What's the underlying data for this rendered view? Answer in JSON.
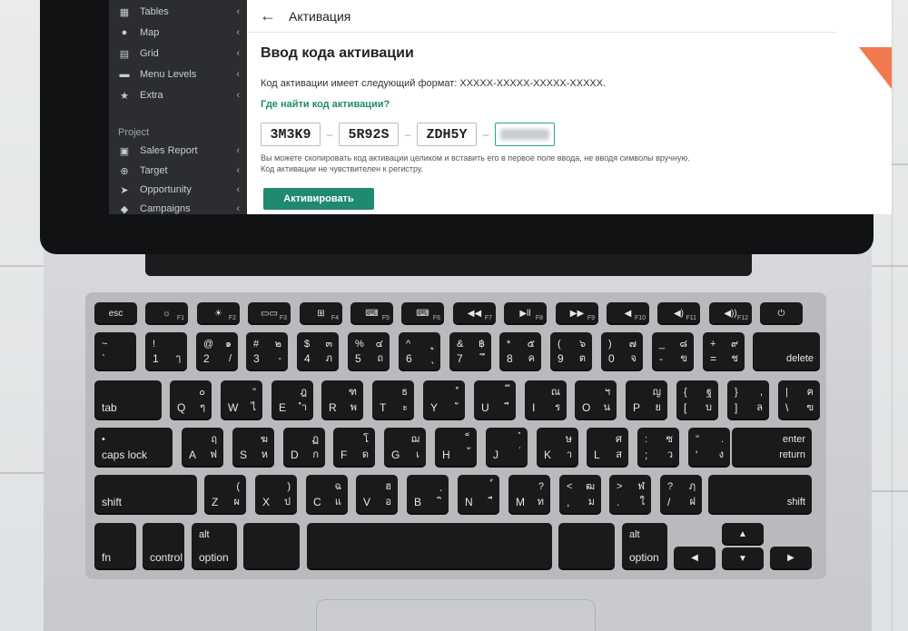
{
  "sidebar": {
    "items": [
      {
        "label": "Tables",
        "icon": "table-icon"
      },
      {
        "label": "Map",
        "icon": "map-pin-icon"
      },
      {
        "label": "Grid",
        "icon": "grid-icon"
      },
      {
        "label": "Menu Levels",
        "icon": "folder-icon"
      },
      {
        "label": "Extra",
        "icon": "star-icon"
      }
    ],
    "section_heading": "Project",
    "project_items": [
      {
        "label": "Sales Report",
        "icon": "report-icon"
      },
      {
        "label": "Target",
        "icon": "target-icon"
      },
      {
        "label": "Opportunity",
        "icon": "rocket-icon"
      },
      {
        "label": "Campaigns",
        "icon": "megaphone-icon"
      }
    ]
  },
  "header": {
    "title": "Активация"
  },
  "main": {
    "heading": "Ввод кода активации",
    "format_text": "Код активации имеет следующий формат: XXXXX-XXXXX-XXXXX-XXXXX.",
    "find_link": "Где найти код активации?",
    "code_parts": [
      "3M3K9",
      "5R92S",
      "ZDH5Y"
    ],
    "code_separator": "–",
    "hint_line1": "Вы можете скопировать код активации целиком и вставить его в первое поле ввода, не вводя символы вручную.",
    "hint_line2": "Код активации не чувствителен к регистру.",
    "activate_button": "Активировать"
  },
  "keyboard": {
    "fn_row": [
      {
        "label": "esc"
      },
      {
        "label": "☼",
        "sub": "F1"
      },
      {
        "label": "☀",
        "sub": "F2"
      },
      {
        "label": "▭▭",
        "sub": "F3"
      },
      {
        "label": "⊞",
        "sub": "F4"
      },
      {
        "label": "⌨",
        "sub": "F5"
      },
      {
        "label": "⌨",
        "sub": "F6"
      },
      {
        "label": "◀◀",
        "sub": "F7"
      },
      {
        "label": "▶ll",
        "sub": "F8"
      },
      {
        "label": "▶▶",
        "sub": "F9"
      },
      {
        "label": "◀",
        "sub": "F10"
      },
      {
        "label": "◀)",
        "sub": "F11"
      },
      {
        "label": "◀))",
        "sub": "F12"
      },
      {
        "label": "⏻"
      }
    ],
    "number_row": [
      {
        "tl": "~",
        "bl": "`",
        "tr": "",
        "br": ""
      },
      {
        "tl": "!",
        "bl": "1",
        "tr": "",
        "br": "ๅ"
      },
      {
        "tl": "@",
        "bl": "2",
        "tr": "๑",
        "br": "/"
      },
      {
        "tl": "#",
        "bl": "3",
        "tr": "๒",
        "br": "-"
      },
      {
        "tl": "$",
        "bl": "4",
        "tr": "๓",
        "br": "ภ"
      },
      {
        "tl": "%",
        "bl": "5",
        "tr": "๔",
        "br": "ถ"
      },
      {
        "tl": "^",
        "bl": "6",
        "tr": "ู",
        "br": "ุ"
      },
      {
        "tl": "&",
        "bl": "7",
        "tr": "฿",
        "br": "ึ"
      },
      {
        "tl": "*",
        "bl": "8",
        "tr": "๕",
        "br": "ค"
      },
      {
        "tl": "(",
        "bl": "9",
        "tr": "๖",
        "br": "ต"
      },
      {
        "tl": ")",
        "bl": "0",
        "tr": "๗",
        "br": "จ"
      },
      {
        "tl": "_",
        "bl": "-",
        "tr": "๘",
        "br": "ข"
      },
      {
        "tl": "+",
        "bl": "=",
        "tr": "๙",
        "br": "ช"
      },
      {
        "label": "delete"
      }
    ],
    "q_row": [
      {
        "label": "tab"
      },
      {
        "bl": "Q",
        "tr": "๐",
        "br": "ๆ"
      },
      {
        "bl": "W",
        "tr": "\"",
        "br": "ไ"
      },
      {
        "bl": "E",
        "tr": "ฎ",
        "br": "ำ"
      },
      {
        "bl": "R",
        "tr": "ฑ",
        "br": "พ"
      },
      {
        "bl": "T",
        "tr": "ธ",
        "br": "ะ"
      },
      {
        "bl": "Y",
        "tr": "ํ",
        "br": "ั"
      },
      {
        "bl": "U",
        "tr": "๊",
        "br": "ี"
      },
      {
        "bl": "I",
        "tr": "ณ",
        "br": "ร"
      },
      {
        "bl": "O",
        "tr": "ฯ",
        "br": "น"
      },
      {
        "bl": "P",
        "tr": "ญ",
        "br": "ย"
      },
      {
        "tl": "{",
        "bl": "[",
        "tr": "ฐ",
        "br": "บ"
      },
      {
        "tl": "}",
        "bl": "]",
        "tr": ",",
        "br": "ล"
      },
      {
        "tl": "|",
        "bl": "\\",
        "tr": "ฅ",
        "br": "ฃ"
      }
    ],
    "a_row": [
      {
        "label": "caps lock"
      },
      {
        "bl": "A",
        "tr": "ฤ",
        "br": "ฟ"
      },
      {
        "bl": "S",
        "tr": "ฆ",
        "br": "ห"
      },
      {
        "bl": "D",
        "tr": "ฏ",
        "br": "ก"
      },
      {
        "bl": "F",
        "tr": "โ",
        "br": "ด"
      },
      {
        "bl": "G",
        "tr": "ฌ",
        "br": "เ"
      },
      {
        "bl": "H",
        "tr": "็",
        "br": "้"
      },
      {
        "bl": "J",
        "tr": "๋",
        "br": "่"
      },
      {
        "bl": "K",
        "tr": "ษ",
        "br": "า"
      },
      {
        "bl": "L",
        "tr": "ศ",
        "br": "ส"
      },
      {
        "tl": ":",
        "bl": ";",
        "tr": "ซ",
        "br": "ว"
      },
      {
        "tl": "\"",
        "bl": "'",
        "tr": ".",
        "br": "ง"
      },
      {
        "label": "enter",
        "label2": "return"
      }
    ],
    "z_row": [
      {
        "label": "shift"
      },
      {
        "bl": "Z",
        "tr": "(",
        "br": "ผ"
      },
      {
        "bl": "X",
        "tr": ")",
        "br": "ป"
      },
      {
        "bl": "C",
        "tr": "ฉ",
        "br": "แ"
      },
      {
        "bl": "V",
        "tr": "ฮ",
        "br": "อ"
      },
      {
        "bl": "B",
        "tr": "ฺ",
        "br": "ิ"
      },
      {
        "bl": "N",
        "tr": "์",
        "br": "ื"
      },
      {
        "bl": "M",
        "tr": "?",
        "br": "ท"
      },
      {
        "tl": "<",
        "bl": ",",
        "tr": "ฒ",
        "br": "ม"
      },
      {
        "tl": ">",
        "bl": ".",
        "tr": "ฬ",
        "br": "ใ"
      },
      {
        "tl": "?",
        "bl": "/",
        "tr": "ฦ",
        "br": "ฝ"
      },
      {
        "label": "shift"
      }
    ],
    "bottom_row": {
      "fn": "fn",
      "control": "control",
      "option_alt": "alt",
      "option": "option",
      "option_right_alt": "alt",
      "option_right": "option",
      "arrow_left": "◀",
      "arrow_up": "▲",
      "arrow_down": "▼",
      "arrow_right": "▶"
    }
  }
}
